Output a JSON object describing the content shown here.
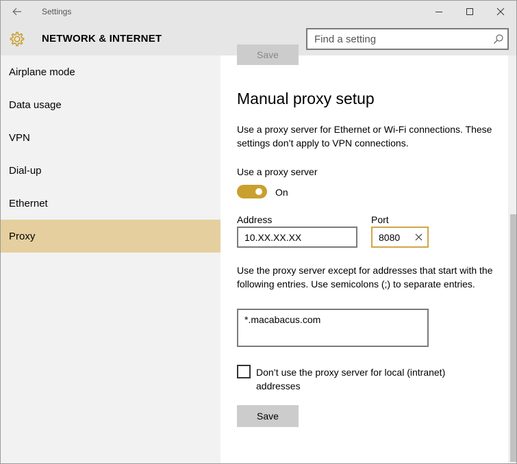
{
  "window": {
    "title": "Settings"
  },
  "header": {
    "title": "NETWORK & INTERNET",
    "search_placeholder": "Find a setting"
  },
  "sidebar": {
    "items": [
      {
        "label": "Airplane mode",
        "active": false
      },
      {
        "label": "Data usage",
        "active": false
      },
      {
        "label": "VPN",
        "active": false
      },
      {
        "label": "Dial-up",
        "active": false
      },
      {
        "label": "Ethernet",
        "active": false
      },
      {
        "label": "Proxy",
        "active": true
      }
    ]
  },
  "main": {
    "top_save_label": "Save",
    "section_title": "Manual proxy setup",
    "description": "Use a proxy server for Ethernet or Wi-Fi connections. These settings don’t apply to VPN connections.",
    "toggle_label": "Use a proxy server",
    "toggle_state": "On",
    "address_label": "Address",
    "address_value": "10.XX.XX.XX",
    "port_label": "Port",
    "port_value": "8080",
    "exceptions_description": "Use the proxy server except for addresses that start with the following entries. Use semicolons (;) to separate entries.",
    "exceptions_value": "*.macabacus.com",
    "local_checkbox_label": "Don’t use the proxy server for local (intranet) addresses",
    "local_checkbox_checked": false,
    "save_label": "Save"
  },
  "colors": {
    "accent": "#c9a02d",
    "active_nav": "#e5cf9e",
    "focus_border": "#d0a64a",
    "chrome": "#e6e6e6"
  },
  "icons": {
    "back": "back-arrow-icon",
    "minimize": "minimize-icon",
    "maximize": "maximize-icon",
    "close": "close-icon",
    "settings": "gear-icon",
    "search": "search-icon",
    "clear": "clear-icon"
  }
}
